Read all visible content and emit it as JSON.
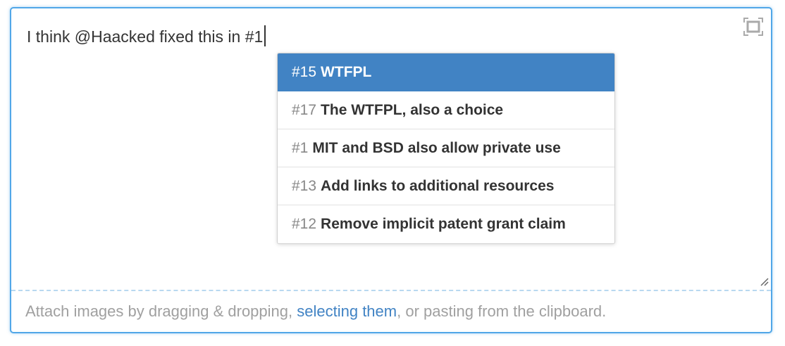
{
  "editor": {
    "text": "I think @Haacked fixed this in #1"
  },
  "suggestions": [
    {
      "number": "#15",
      "title": "WTFPL",
      "active": true
    },
    {
      "number": "#17",
      "title": "The WTFPL, also a choice",
      "active": false
    },
    {
      "number": "#1",
      "title": "MIT and BSD also allow private use",
      "active": false
    },
    {
      "number": "#13",
      "title": "Add links to additional resources",
      "active": false
    },
    {
      "number": "#12",
      "title": "Remove implicit patent grant claim",
      "active": false
    }
  ],
  "dropzone": {
    "before": "Attach images by dragging & dropping, ",
    "link": "selecting them",
    "after": ", or pasting from the clipboard."
  },
  "icons": {
    "fullscreen": "fullscreen-icon",
    "resize": "resize-handle-icon"
  },
  "colors": {
    "focus_border": "#51a7e8",
    "active_item": "#4183c4",
    "link": "#4183c4",
    "placeholder": "#a0a0a0"
  }
}
